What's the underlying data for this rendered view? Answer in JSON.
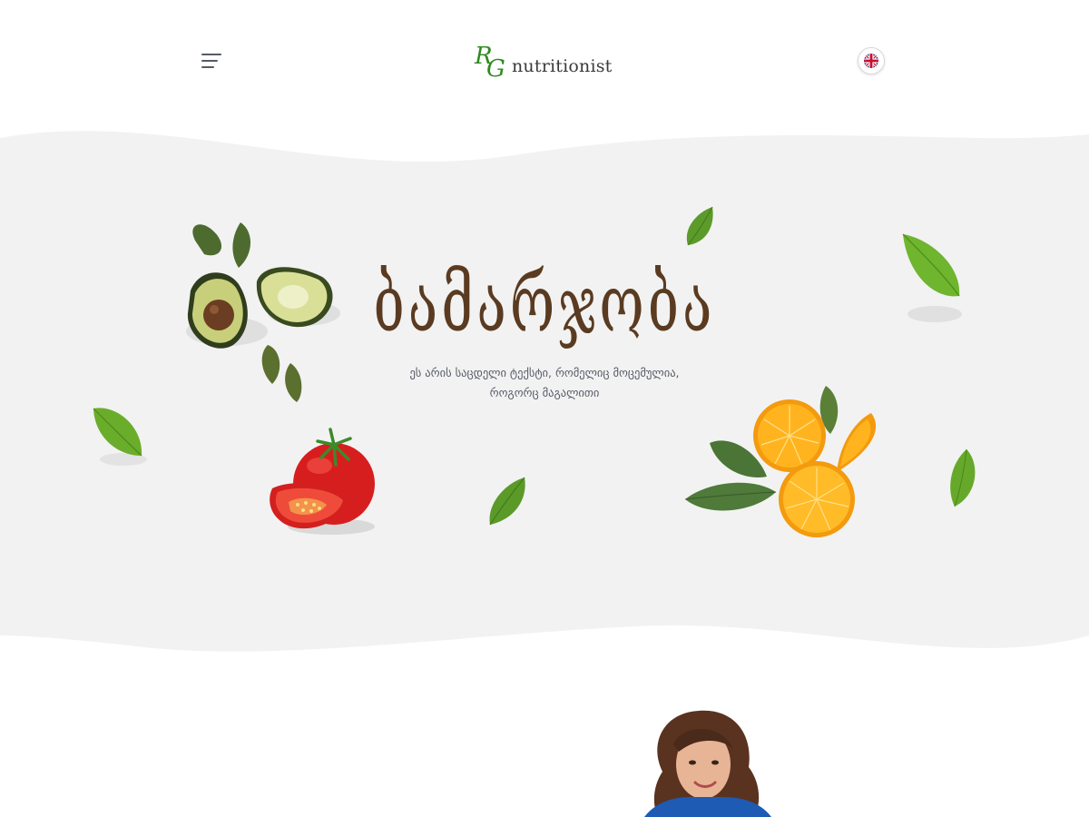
{
  "header": {
    "logo_text": "nutritionist",
    "logo_monogram": "RG",
    "menu_icon": "hamburger-menu-icon",
    "language_icon": "uk-flag-icon"
  },
  "hero": {
    "title": "ბამარჯობა",
    "subtitle_line1": "ეს არის საცდელი ტექსტი, რომელიც მოცემულია,",
    "subtitle_line2": "როგორც მაგალითი"
  },
  "colors": {
    "brand_green": "#2f8a1f",
    "title_brown": "#5a3b21",
    "hero_background": "#f2f2f2",
    "text_gray": "#575b66"
  }
}
